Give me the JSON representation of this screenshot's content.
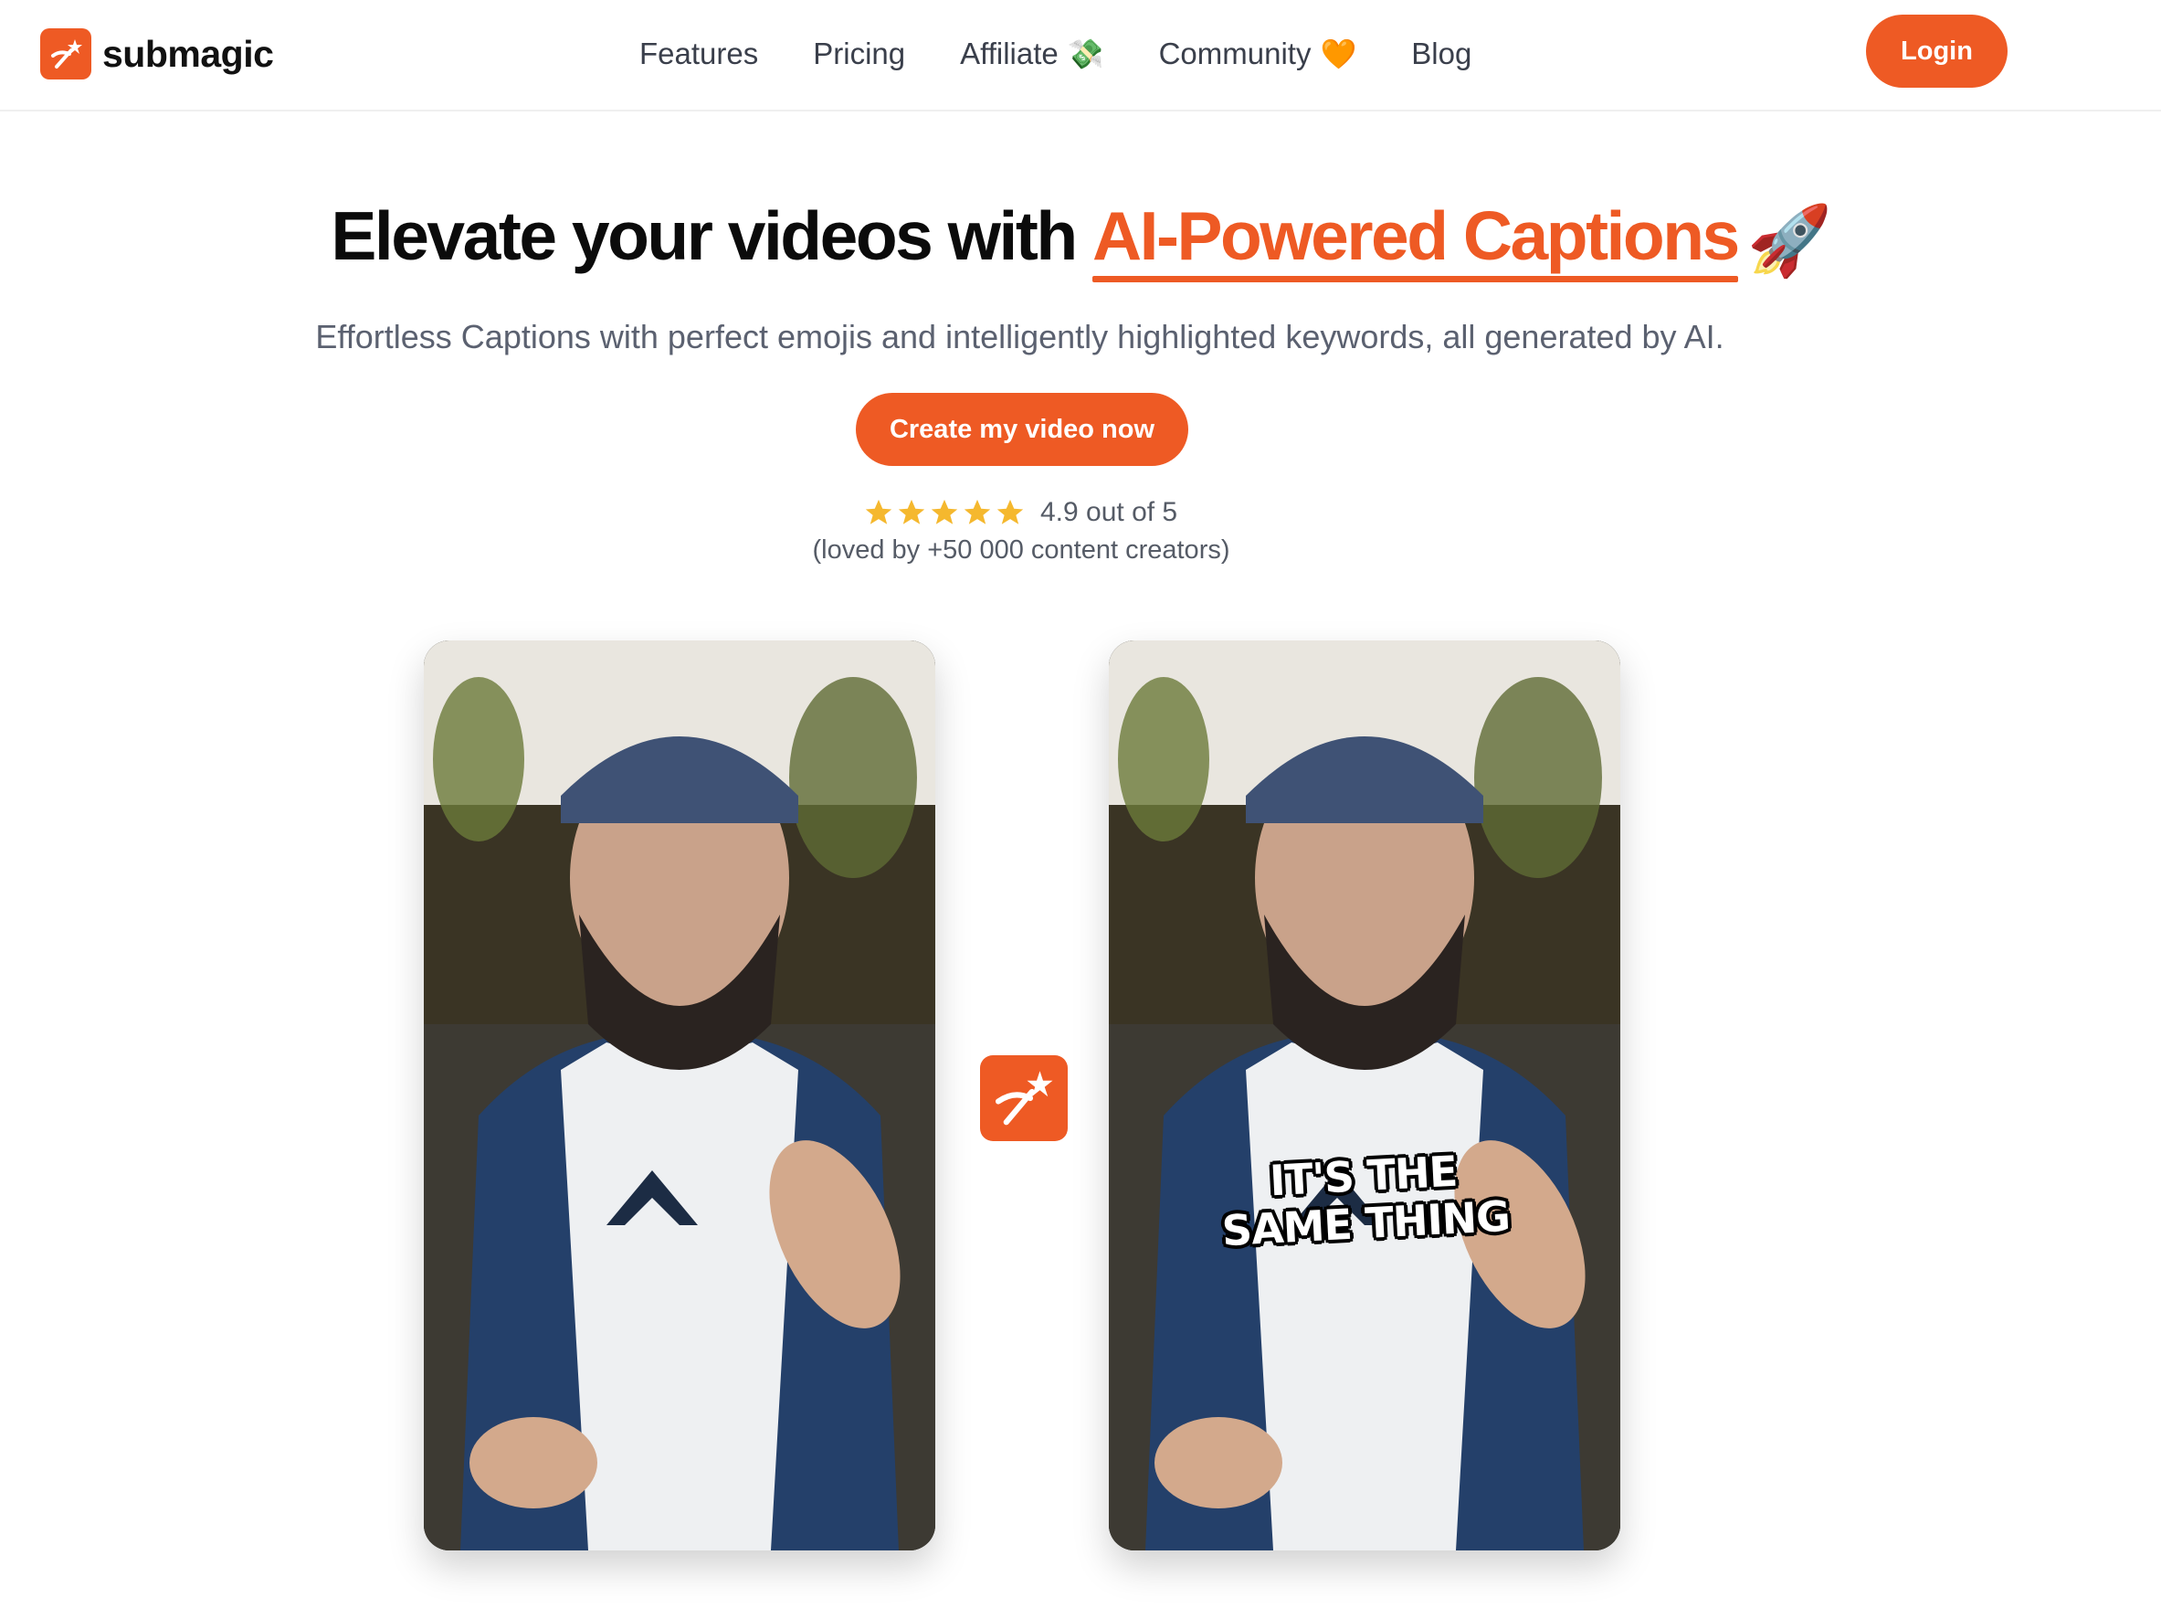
{
  "brand": {
    "name": "submagic",
    "accent_color": "#ee5a24"
  },
  "nav": {
    "items": [
      {
        "label": "Features",
        "emoji": ""
      },
      {
        "label": "Pricing",
        "emoji": ""
      },
      {
        "label": "Affiliate",
        "emoji": "💸"
      },
      {
        "label": "Community",
        "emoji": "🧡"
      },
      {
        "label": "Blog",
        "emoji": ""
      }
    ],
    "login_label": "Login"
  },
  "hero": {
    "title_prefix": "Elevate your videos with ",
    "title_accent": "AI-Powered Captions",
    "title_emoji": "🚀",
    "subtitle": "Effortless Captions with perfect emojis and intelligently highlighted keywords, all generated by AI.",
    "cta_label": "Create my video now",
    "rating": {
      "stars": 5,
      "text": "4.9 out of 5",
      "loved_text": "(loved by +50 000 content creators)"
    }
  },
  "videos": {
    "before": {
      "caption": ""
    },
    "after": {
      "caption_line1": "IT'S THE",
      "caption_line2": "SAME THING"
    }
  }
}
